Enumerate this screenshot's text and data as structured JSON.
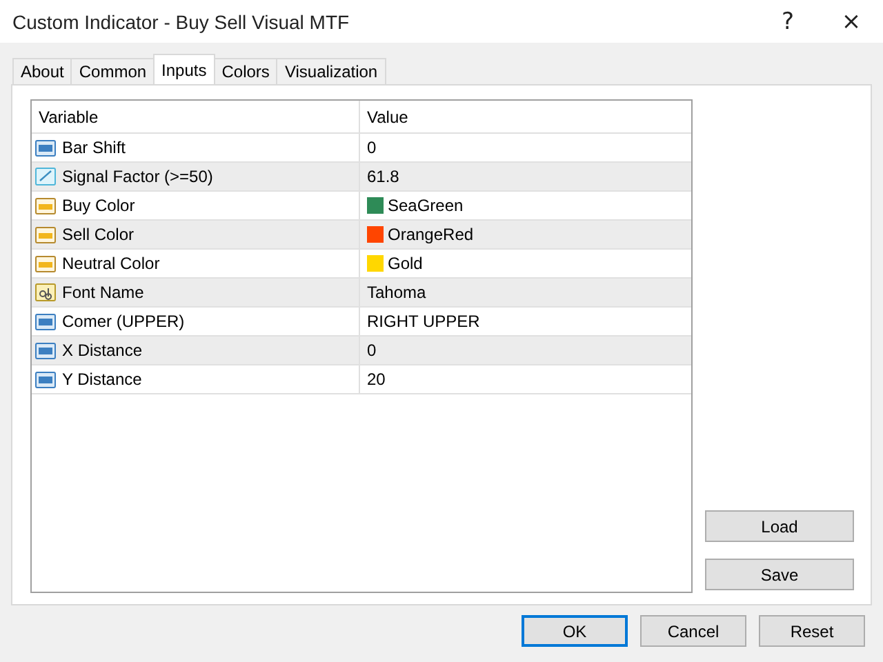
{
  "window": {
    "title": "Custom Indicator - Buy Sell Visual MTF",
    "help": "?",
    "close": "×"
  },
  "tabs": [
    {
      "label": "About",
      "selected": false
    },
    {
      "label": "Common",
      "selected": false
    },
    {
      "label": "Inputs",
      "selected": true
    },
    {
      "label": "Colors",
      "selected": false
    },
    {
      "label": "Visualization",
      "selected": false
    }
  ],
  "table": {
    "columns": [
      "Variable",
      "Value"
    ],
    "rows": [
      {
        "kind": "integer",
        "variable": "Bar Shift",
        "value": "0"
      },
      {
        "kind": "double",
        "variable": "Signal Factor (>=50)",
        "value": "61.8"
      },
      {
        "kind": "color",
        "variable": "Buy Color",
        "value": "SeaGreen",
        "color": "#2e8b57"
      },
      {
        "kind": "color",
        "variable": "Sell Color",
        "value": "OrangeRed",
        "color": "#ff4500"
      },
      {
        "kind": "color",
        "variable": "Neutral Color",
        "value": "Gold",
        "color": "#ffd700"
      },
      {
        "kind": "string",
        "variable": "Font Name",
        "value": "Tahoma"
      },
      {
        "kind": "integer",
        "variable": "Comer (UPPER)",
        "value": "RIGHT UPPER"
      },
      {
        "kind": "integer",
        "variable": "X Distance",
        "value": "0"
      },
      {
        "kind": "integer",
        "variable": "Y Distance",
        "value": "20"
      }
    ]
  },
  "side_buttons": [
    "Load",
    "Save"
  ],
  "buttons": [
    {
      "label": "OK",
      "default": true
    },
    {
      "label": "Cancel",
      "default": false
    },
    {
      "label": "Reset",
      "default": false
    }
  ]
}
